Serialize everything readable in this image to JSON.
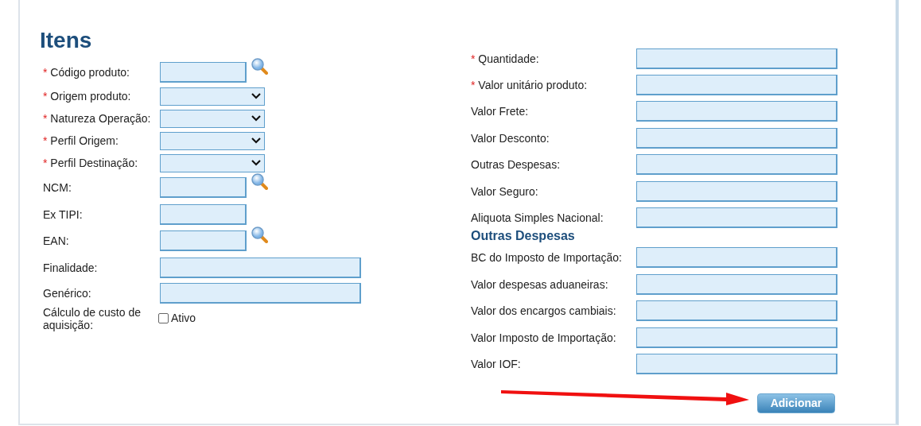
{
  "section_title": "Itens",
  "left_fields": [
    {
      "marker": "*",
      "label": "Código produto:",
      "kind": "short_input",
      "search": true
    },
    {
      "marker": "*",
      "label": "Origem produto:",
      "kind": "select"
    },
    {
      "marker": "*",
      "label": "Natureza Operação:",
      "kind": "select"
    },
    {
      "marker": "*",
      "label": "Perfil Origem:",
      "kind": "select"
    },
    {
      "marker": "*",
      "label": "Perfil Destinação:",
      "kind": "select"
    },
    {
      "label": "NCM:",
      "kind": "short_input",
      "search": true
    },
    {
      "label": "Ex TIPI:",
      "kind": "short_input"
    },
    {
      "label": "EAN:",
      "kind": "short_input",
      "search": true
    },
    {
      "label": "Finalidade:",
      "kind": "long_input"
    },
    {
      "label": "Genérico:",
      "kind": "long_input"
    },
    {
      "label": "Cálculo de custo de aquisição:",
      "kind": "checkbox",
      "option": "Ativo",
      "checked": false
    }
  ],
  "right_fields": [
    {
      "marker": "*",
      "label": "Quantidade:",
      "kind": "input"
    },
    {
      "marker": "*",
      "label": "Valor unitário produto:",
      "kind": "input"
    },
    {
      "label": "Valor Frete:",
      "kind": "input"
    },
    {
      "label": "Valor Desconto:",
      "kind": "input"
    },
    {
      "label": "Outras Despesas:",
      "kind": "input"
    },
    {
      "label": "Valor Seguro:",
      "kind": "input"
    },
    {
      "label": "Aliquota Simples Nacional:",
      "kind": "input"
    },
    {
      "label": "Outras Despesas",
      "kind": "heading"
    },
    {
      "label": "BC do Imposto de Importação:",
      "kind": "input"
    },
    {
      "label": "Valor despesas aduaneiras:",
      "kind": "input"
    },
    {
      "label": "Valor dos encargos cambiais:",
      "kind": "input"
    },
    {
      "label": "Valor Imposto de Importação:",
      "kind": "input"
    },
    {
      "label": "Valor IOF:",
      "kind": "input"
    }
  ],
  "annotation": {
    "kind": "arrow"
  },
  "button": "Adicionar"
}
